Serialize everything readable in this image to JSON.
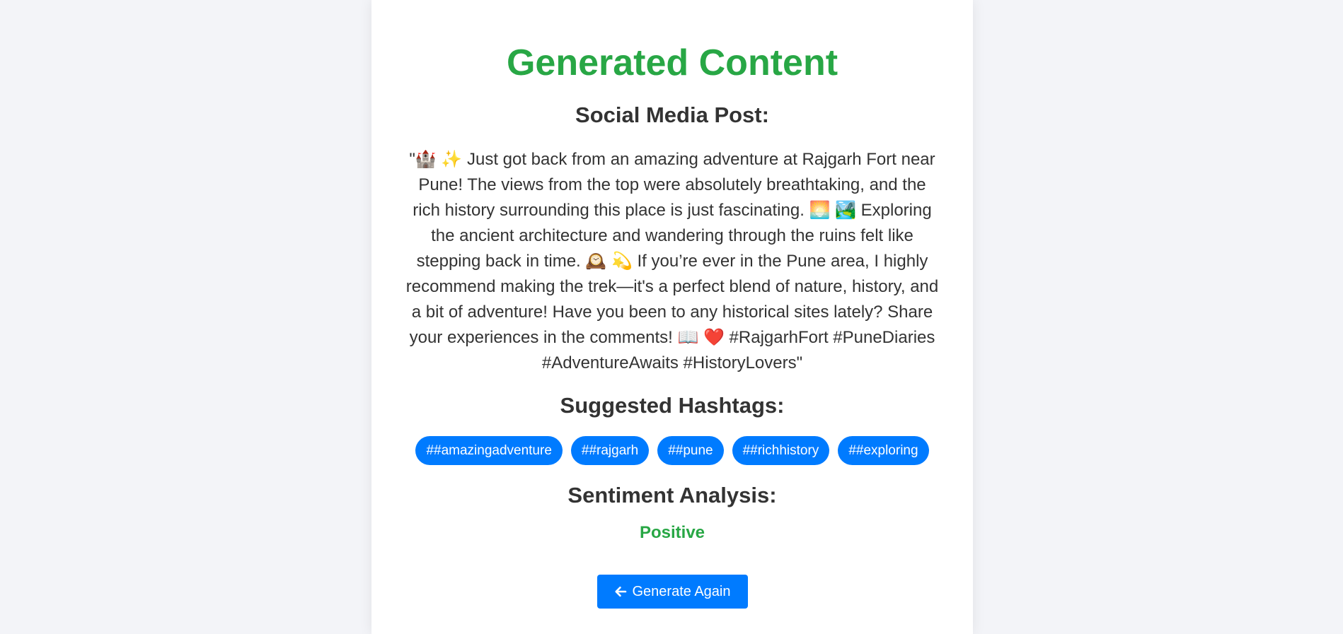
{
  "page": {
    "title": "Generated Content",
    "accent_color": "#28a745",
    "primary_color": "#007bff"
  },
  "post": {
    "heading": "Social Media Post:",
    "text": "\"🏰 ✨ Just got back from an amazing adventure at Rajgarh Fort near Pune! The views from the top were absolutely breathtaking, and the rich history surrounding this place is just fascinating. 🌅 🏞️ Exploring the ancient architecture and wandering through the ruins felt like stepping back in time. 🕰️ 💫 If you’re ever in the Pune area, I highly recommend making the trek—it's a perfect blend of nature, history, and a bit of adventure! Have you been to any historical sites lately? Share your experiences in the comments! 📖 ❤️ #RajgarhFort #PuneDiaries #AdventureAwaits #HistoryLovers\""
  },
  "hashtags": {
    "heading": "Suggested Hashtags:",
    "items": [
      "##amazingadventure",
      "##rajgarh",
      "##pune",
      "##richhistory",
      "##exploring"
    ]
  },
  "sentiment": {
    "heading": "Sentiment Analysis:",
    "value": "Positive"
  },
  "actions": {
    "generate_again_label": "Generate Again",
    "generate_again_icon": "arrow-left-icon"
  }
}
